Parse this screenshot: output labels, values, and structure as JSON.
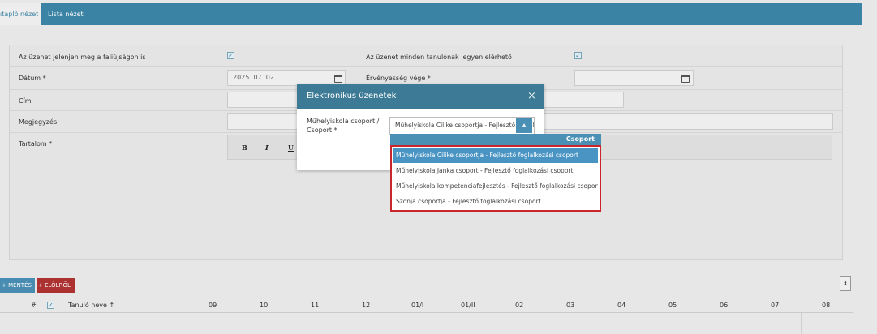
{
  "tabs": {
    "active": "ıtapló nézet",
    "list": "Lista nézet"
  },
  "form": {
    "show_on_wall_label": "Az üzenet jelenjen meg a faliújságon is",
    "all_students_label": "Az üzenet minden tanulónak legyen elérhető",
    "date_label": "Dátum *",
    "date_value": "2025. 07. 02.",
    "validity_label": "Érvényesség vége *",
    "title_label": "Cím",
    "note_label": "Megjegyzés",
    "content_label": "Tartalom *",
    "editor": {
      "bold": "B",
      "italic": "I",
      "underline": "U"
    }
  },
  "bottom": {
    "save_label": "MENTÉS",
    "reset_label": "ELÖLRŐL",
    "sort_glyph": "⬍",
    "columns": [
      "#",
      "Tanuló neve",
      "09",
      "10",
      "11",
      "12",
      "01/I",
      "01/II",
      "02",
      "03",
      "04",
      "05",
      "06",
      "07",
      "08"
    ],
    "sort_arrow": "↑"
  },
  "modal": {
    "title": "Elektronikus üzenetek",
    "close": "×",
    "field_label": "Műhelyiskola csoport / Csoport *",
    "select_value": "Műhelyiskola Cilike csoportja - Fejlesztő foglalkozási csoport",
    "caret": "▲"
  },
  "dropdown": {
    "header": "Csoport",
    "options": [
      "Műhelyiskola Cilike csoportja - Fejlesztő foglalkozási csoport",
      "Műhelyiskola Janka csoport - Fejlesztő foglalkozási csoport",
      "Műhelyiskola kompetenciafejlesztés - Fejlesztő foglalkozási csoport",
      "Szonja csoportja - Fejlesztő foglalkozási csoport"
    ],
    "selected_index": 0
  },
  "colors": {
    "accent": "#3c86a8",
    "modal_header": "#3c7a95",
    "selected_option": "#4a94c4",
    "highlight_border": "#c8262b",
    "reset_button": "#b03232"
  }
}
